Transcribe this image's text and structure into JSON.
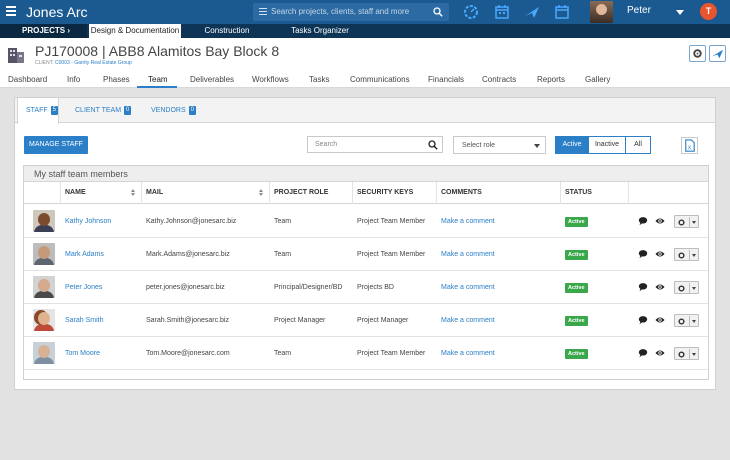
{
  "app": {
    "title": "Jones Arc",
    "user_name": "Peter",
    "notif_letter": "T"
  },
  "search": {
    "placeholder": "Search projects, clients, staff and more"
  },
  "sections": {
    "projects_label": "PROJECTS",
    "projects_chevron": "›",
    "tabs": [
      "Design & Documentation",
      "Construction",
      "Tasks Organizer"
    ]
  },
  "project": {
    "title": "PJ170008 | ABB8 Alamitos Bay Block 8",
    "client_prefix": "CLIENT:",
    "client_code": "C0003",
    "client_sep": " - ",
    "client_name": "Garrity Real Estate Group"
  },
  "module_tabs": [
    "Dashboard",
    "Info",
    "Phases",
    "Team",
    "Deliverables",
    "Workflows",
    "Tasks",
    "Communications",
    "Financials",
    "Contracts",
    "Reports",
    "Gallery"
  ],
  "sub_tabs": [
    {
      "label": "STAFF",
      "count": "5"
    },
    {
      "label": "CLIENT TEAM",
      "count": "0"
    },
    {
      "label": "VENDORS",
      "count": "0"
    }
  ],
  "toolbar": {
    "manage_label": "MANAGE STAFF",
    "search_placeholder": "Search",
    "role_placeholder": "Select role",
    "filters": [
      "Active",
      "Inactive",
      "All"
    ]
  },
  "table": {
    "title": "My staff team members",
    "headers": [
      "NAME",
      "MAIL",
      "PROJECT ROLE",
      "SECURITY KEYS",
      "COMMENTS",
      "STATUS"
    ],
    "rows": [
      {
        "name": "Kathy Johnson",
        "mail": "Kathy.Johnson@jonesarc.biz",
        "role": "Team",
        "keys": "Project Team Member",
        "comment": "Make a comment",
        "status": "Active"
      },
      {
        "name": "Mark Adams",
        "mail": "Mark.Adams@jonesarc.biz",
        "role": "Team",
        "keys": "Project Team Member",
        "comment": "Make a comment",
        "status": "Active"
      },
      {
        "name": "Peter Jones",
        "mail": "peter.jones@jonesarc.biz",
        "role": "Principal/Designer/BD",
        "keys": "Projects BD",
        "comment": "Make a comment",
        "status": "Active"
      },
      {
        "name": "Sarah Smith",
        "mail": "Sarah.Smith@jonesarc.biz",
        "role": "Project Manager",
        "keys": "Project Manager",
        "comment": "Make a comment",
        "status": "Active"
      },
      {
        "name": "Tom Moore",
        "mail": "Tom.Moore@jonesarc.com",
        "role": "Team",
        "keys": "Project Team Member",
        "comment": "Make a comment",
        "status": "Active"
      }
    ]
  },
  "colors": {
    "primary": "#1b5a90",
    "dark_nav": "#0f3556",
    "accent": "#2a7fc7",
    "active_green": "#3aa84a",
    "notif_orange": "#e9542f"
  },
  "icons": [
    "hamburger-icon",
    "search-icon",
    "dashboard-icon",
    "calendar-icon",
    "plane-icon",
    "building-icon",
    "gear-icon",
    "comment-icon",
    "eye-icon",
    "export-icon"
  ]
}
